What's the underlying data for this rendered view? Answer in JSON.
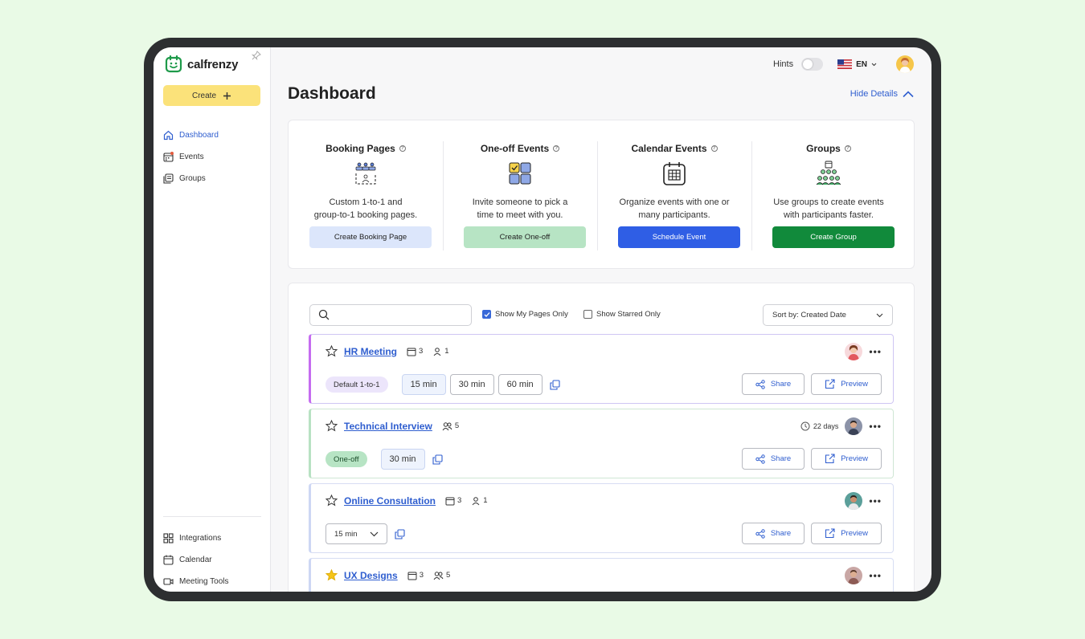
{
  "app": {
    "name": "calfrenzy"
  },
  "sidebar": {
    "create_label": "Create",
    "nav": [
      {
        "label": "Dashboard",
        "icon": "home-icon",
        "active": true
      },
      {
        "label": "Events",
        "icon": "calendar-icon"
      },
      {
        "label": "Groups",
        "icon": "groups-icon"
      }
    ],
    "bottom": [
      {
        "label": "Integrations",
        "icon": "grid-icon"
      },
      {
        "label": "Calendar",
        "icon": "calendar-icon"
      },
      {
        "label": "Meeting Tools",
        "icon": "video-icon"
      }
    ]
  },
  "topbar": {
    "hints_label": "Hints",
    "language": "EN"
  },
  "page": {
    "title": "Dashboard",
    "hide_details": "Hide Details"
  },
  "features": [
    {
      "title": "Booking Pages",
      "desc1": "Custom 1-to-1 and",
      "desc2": "group-to-1 booking pages.",
      "button": "Create Booking Page"
    },
    {
      "title": "One-off Events",
      "desc1": "Invite someone to pick a",
      "desc2": "time to meet with you.",
      "button": "Create One-off"
    },
    {
      "title": "Calendar Events",
      "desc1": "Organize events with one or",
      "desc2": "many participants.",
      "button": "Schedule Event"
    },
    {
      "title": "Groups",
      "desc1": "Use groups to create events",
      "desc2": "with participants faster.",
      "button": "Create Group"
    }
  ],
  "filters": {
    "search_placeholder": "",
    "show_my_pages": "Show My Pages Only",
    "show_starred": "Show Starred Only",
    "sort": "Sort by: Created Date"
  },
  "items": [
    {
      "title": "HR Meeting",
      "calendars": "3",
      "people": "1",
      "tag": "Default 1-to-1",
      "durations": [
        "15 min",
        "30 min",
        "60 min"
      ],
      "share": "Share",
      "preview": "Preview"
    },
    {
      "title": "Technical Interview",
      "people": "5",
      "days": "22 days",
      "tag": "One-off",
      "durations": [
        "30 min"
      ],
      "share": "Share",
      "preview": "Preview"
    },
    {
      "title": "Online Consultation",
      "calendars": "3",
      "people": "1",
      "select_duration": "15 min",
      "share": "Share",
      "preview": "Preview"
    },
    {
      "title": "UX Designs",
      "calendars": "3",
      "people": "5"
    }
  ],
  "colors": {
    "accent": "#2f5ecf",
    "create": "#fbe27a",
    "booking": "#dce6fb",
    "oneoff": "#b7e4c4",
    "schedule": "#2f5ee5",
    "group": "#118a3b"
  }
}
